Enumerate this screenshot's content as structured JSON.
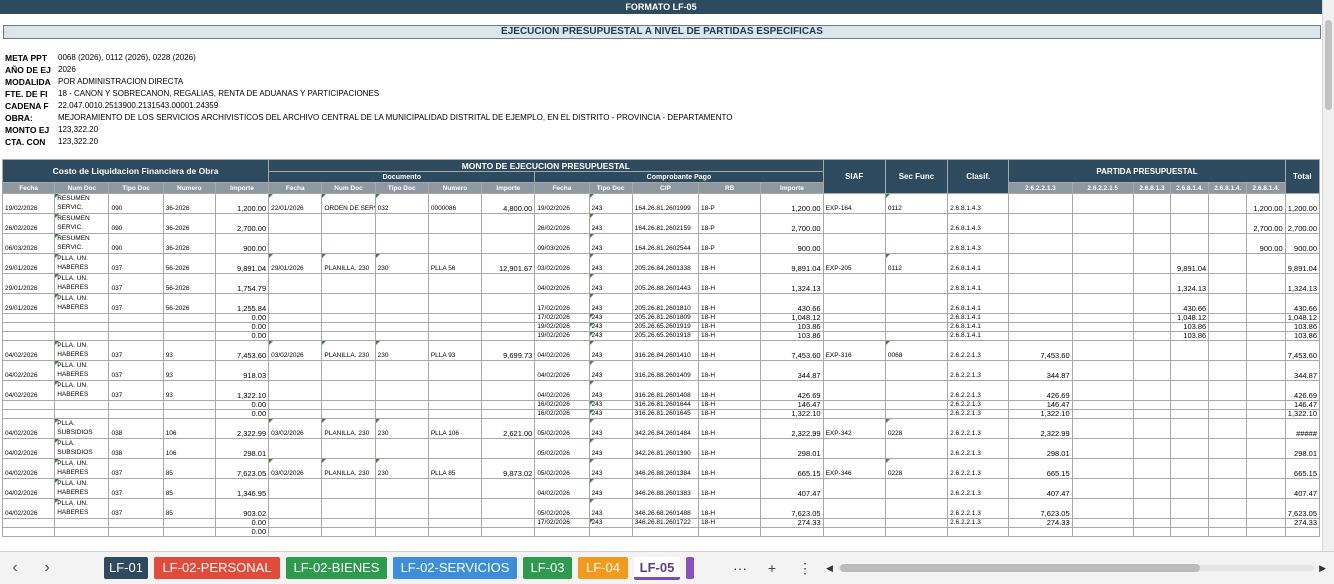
{
  "banner": "FORMATO LF-05",
  "title": "EJECUCION PRESUPUESTAL A NIVEL DE PARTIDAS ESPECIFICAS",
  "info": [
    {
      "label": "META PPT",
      "value": "0068 (2026), 0112 (2026), 0228 (2026)"
    },
    {
      "label": "AÑO DE EJ",
      "value": "2026"
    },
    {
      "label": "MODALIDA",
      "value": "POR ADMINISTRACION DIRECTA"
    },
    {
      "label": "FTE. DE FI",
      "value": "18 - CANON Y SOBRECANON, REGALIAS, RENTA DE ADUANAS Y PARTICIPACIONES"
    },
    {
      "label": "CADENA F",
      "value": "22.047.0010.2513900.2131543.00001.24359"
    },
    {
      "label": "OBRA:",
      "value": "MEJORAMIENTO DE LOS SERVICIOS ARCHIVISTICOS DEL ARCHIVO CENTRAL DE LA MUNICIPALIDAD DISTRITAL DE EJEMPLO, EN EL DISTRITO - PROVINCIA - DEPARTAMENTO"
    },
    {
      "label": "MONTO EJ",
      "value": "123,322.20"
    },
    {
      "label": "CTA. CON",
      "value": "123,322.20"
    }
  ],
  "headers": {
    "costo": "Costo de Liquidacion Financiera de Obra",
    "monto": "MONTO DE EJECUCION PRESUPUESTAL",
    "documento": "Documento",
    "comprobante": "Comprobante Pago",
    "siaf": "SIAF",
    "sec_func": "Sec Func",
    "clasif": "Clasif.",
    "partida": "PARTIDA PRESUPUESTAL",
    "total": "Total",
    "sub": [
      "Fecha",
      "Num Doc",
      "Tipo Doc",
      "Numero",
      "Importe",
      "Fecha",
      "Num Doc",
      "Tipo Doc",
      "Numero",
      "Importe",
      "Fecha",
      "Tipo Doc",
      "C/P",
      "RB",
      "Importe"
    ],
    "partidas": [
      "2.6.2.2.1.3",
      "2.6.2.2.1.5",
      "2.6.8.1.3",
      "2.6.8.1.4.",
      "2.6.8.1.4.",
      "2.6.8.1.4."
    ]
  },
  "rows": [
    {
      "h": 2,
      "c": [
        "19/02/2026",
        "RESUMEN SERVIC.",
        "090",
        "36-2026",
        "1,200.00",
        "22/01/2026",
        "ORDEN DE SERVIC.",
        "032",
        "0000086",
        "4,800.00",
        "19/02/2026",
        "243",
        "164.26.81.2601999",
        "18-P",
        "1,200.00",
        "EXP-164",
        "0112",
        "2.6.8.1.4.3",
        "",
        "",
        "",
        "",
        "",
        "1,200.00",
        "1,200.00"
      ]
    },
    {
      "h": 2,
      "c": [
        "26/02/2026",
        "RESUMEN SERVIC.",
        "090",
        "36-2026",
        "2,700.00",
        "",
        "",
        "",
        "",
        "",
        "26/02/2026",
        "243",
        "164.26.81.2602159",
        "18-P",
        "2,700.00",
        "",
        "",
        "2.6.8.1.4.3",
        "",
        "",
        "",
        "",
        "",
        "2,700.00",
        "2,700.00"
      ]
    },
    {
      "h": 2,
      "c": [
        "06/03/2026",
        "RESUMEN SERVIC.",
        "090",
        "36-2026",
        "900.00",
        "",
        "",
        "",
        "",
        "",
        "09/03/2026",
        "243",
        "164.26.81.2602544",
        "18-P",
        "900.00",
        "",
        "",
        "2.6.8.1.4.3",
        "",
        "",
        "",
        "",
        "",
        "900.00",
        "900.00"
      ]
    },
    {
      "h": 2,
      "c": [
        "29/01/2026",
        "PLLA. UN. HABERES",
        "037",
        "56-2026",
        "9,891.04",
        "29/01/2026",
        "PLANILLA. 230",
        "230",
        "PLLA 56",
        "12,901.67",
        "03/02/2026",
        "243",
        "205.26.84.2601338",
        "18-H",
        "9,891.04",
        "EXP-205",
        "0112",
        "2.6.8.1.4.1",
        "",
        "",
        "",
        "9,891.04",
        "",
        "",
        "9,891.04"
      ]
    },
    {
      "h": 2,
      "c": [
        "29/01/2026",
        "PLLA. UN. HABERES",
        "037",
        "56-2026",
        "1,754.79",
        "",
        "",
        "",
        "",
        "",
        "04/02/2026",
        "243",
        "205.26.88.2601443",
        "18-H",
        "1,324.13",
        "",
        "",
        "2.6.8.1.4.1",
        "",
        "",
        "",
        "1,324.13",
        "",
        "",
        "1,324.13"
      ]
    },
    {
      "h": 2,
      "c": [
        "29/01/2026",
        "PLLA. UN. HABERES",
        "037",
        "56-2026",
        "1,255.84",
        "",
        "",
        "",
        "",
        "",
        "17/02/2026",
        "243",
        "205.26.81.2601810",
        "18-H",
        "430.66",
        "",
        "",
        "2.6.8.1.4.1",
        "",
        "",
        "",
        "430.66",
        "",
        "",
        "430.66"
      ]
    },
    {
      "h": 1,
      "c": [
        "",
        "",
        "",
        "",
        "0.00",
        "",
        "",
        "",
        "",
        "",
        "17/02/2026",
        "243",
        "205.26.81.2601809",
        "18-H",
        "1,048.12",
        "",
        "",
        "2.6.8.1.4.1",
        "",
        "",
        "",
        "1,048.12",
        "",
        "",
        "1,048.12"
      ]
    },
    {
      "h": 1,
      "c": [
        "",
        "",
        "",
        "",
        "0.00",
        "",
        "",
        "",
        "",
        "",
        "19/02/2026",
        "243",
        "205.26.65.2601919",
        "18-H",
        "103.86",
        "",
        "",
        "2.6.8.1.4.1",
        "",
        "",
        "",
        "103.86",
        "",
        "",
        "103.86"
      ]
    },
    {
      "h": 1,
      "c": [
        "",
        "",
        "",
        "",
        "0.00",
        "",
        "",
        "",
        "",
        "",
        "19/02/2026",
        "243",
        "205.26.65.2601918",
        "18-H",
        "103.86",
        "",
        "",
        "2.6.8.1.4.1",
        "",
        "",
        "",
        "103.86",
        "",
        "",
        "103.86"
      ]
    },
    {
      "h": 2,
      "c": [
        "04/02/2026",
        "PLLA. UN. HABERES",
        "037",
        "93",
        "7,453.60",
        "03/02/2026",
        "PLANILLA. 230",
        "230",
        "PLLA 93",
        "9,699.73",
        "04/02/2026",
        "243",
        "316.26.84.2601410",
        "18-H",
        "7,453.60",
        "EXP-316",
        "0068",
        "2.6.2.2.1.3",
        "7,453.60",
        "",
        "",
        "",
        "",
        "",
        "7,453.60"
      ]
    },
    {
      "h": 2,
      "c": [
        "04/02/2026",
        "PLLA. UN. HABERES",
        "037",
        "93",
        "918.03",
        "",
        "",
        "",
        "",
        "",
        "04/02/2026",
        "243",
        "316.26.88.2601409",
        "18-H",
        "344.87",
        "",
        "",
        "2.6.2.2.1.3",
        "344.87",
        "",
        "",
        "",
        "",
        "",
        "344.87"
      ]
    },
    {
      "h": 2,
      "c": [
        "04/02/2026",
        "PLLA. UN. HABERES",
        "037",
        "93",
        "1,322.10",
        "",
        "",
        "",
        "",
        "",
        "04/02/2026",
        "243",
        "316.26.81.2601408",
        "18-H",
        "426.69",
        "",
        "",
        "2.6.2.2.1.3",
        "426.69",
        "",
        "",
        "",
        "",
        "",
        "426.69"
      ]
    },
    {
      "h": 1,
      "c": [
        "",
        "",
        "",
        "",
        "0.00",
        "",
        "",
        "",
        "",
        "",
        "16/02/2026",
        "243",
        "316.26.81.2601644",
        "18-H",
        "146.47",
        "",
        "",
        "2.6.2.2.1.3",
        "146.47",
        "",
        "",
        "",
        "",
        "",
        "146.47"
      ]
    },
    {
      "h": 1,
      "c": [
        "",
        "",
        "",
        "",
        "0.00",
        "",
        "",
        "",
        "",
        "",
        "16/02/2026",
        "243",
        "316.26.81.2601645",
        "18-H",
        "1,322.10",
        "",
        "",
        "2.6.2.2.1.3",
        "1,322.10",
        "",
        "",
        "",
        "",
        "",
        "1,322.10"
      ]
    },
    {
      "h": 2,
      "c": [
        "04/02/2026",
        "PLLA. SUBSIDIOS",
        "038",
        "106",
        "2,322.99",
        "03/02/2026",
        "PLANILLA. 230",
        "230",
        "PLLA 106",
        "2,621.00",
        "05/02/2026",
        "243",
        "342.26.84.2601484",
        "18-H",
        "2,322.99",
        "EXP-342",
        "0228",
        "2.6.2.2.1.3",
        "2,322.99",
        "",
        "",
        "",
        "",
        "",
        "#####"
      ]
    },
    {
      "h": 2,
      "c": [
        "04/02/2026",
        "PLLA. SUBSIDIOS",
        "038",
        "106",
        "298.01",
        "",
        "",
        "",
        "",
        "",
        "05/02/2026",
        "243",
        "342.26.81.2601390",
        "18-H",
        "298.01",
        "",
        "",
        "2.6.2.2.1.3",
        "298.01",
        "",
        "",
        "",
        "",
        "",
        "298.01"
      ]
    },
    {
      "h": 2,
      "c": [
        "04/02/2026",
        "PLLA. UN. HABERES",
        "037",
        "85",
        "7,623.05",
        "03/02/2026",
        "PLANILLA. 230",
        "230",
        "PLLA 85",
        "9,873.02",
        "05/02/2026",
        "243",
        "346.26.88.2601384",
        "18-H",
        "665.15",
        "EXP-346",
        "0228",
        "2.6.2.2.1.3",
        "665.15",
        "",
        "",
        "",
        "",
        "",
        "665.15"
      ]
    },
    {
      "h": 2,
      "c": [
        "04/02/2026",
        "PLLA. UN. HABERES",
        "037",
        "85",
        "1,346.95",
        "",
        "",
        "",
        "",
        "",
        "04/02/2026",
        "243",
        "346.26.88.2601383",
        "18-H",
        "407.47",
        "",
        "",
        "2.6.2.2.1.3",
        "407.47",
        "",
        "",
        "",
        "",
        "",
        "407.47"
      ]
    },
    {
      "h": 2,
      "c": [
        "04/02/2026",
        "PLLA. UN. HABERES",
        "037",
        "85",
        "903.02",
        "",
        "",
        "",
        "",
        "",
        "05/02/2026",
        "243",
        "346.26.68.2601488",
        "18-H",
        "7,623.05",
        "",
        "",
        "2.6.2.2.1.3",
        "7,623.05",
        "",
        "",
        "",
        "",
        "",
        "7,623.05"
      ]
    },
    {
      "h": 1,
      "c": [
        "",
        "",
        "",
        "",
        "0.00",
        "",
        "",
        "",
        "",
        "",
        "17/02/2026",
        "243",
        "346.26.81.2601722",
        "18-H",
        "274.33",
        "",
        "",
        "2.6.2.2.1.3",
        "274.33",
        "",
        "",
        "",
        "",
        "",
        "274.33"
      ]
    },
    {
      "h": 1,
      "c": [
        "",
        "",
        "",
        "",
        "0.00",
        "",
        "",
        "",
        "",
        "",
        "",
        "",
        "",
        "",
        "",
        "",
        "",
        "",
        "",
        "",
        "",
        "",
        "",
        "",
        ""
      ]
    }
  ],
  "tabs": [
    {
      "label": "LF-01",
      "bg": "#2e4a5e",
      "fg": "#ffffff"
    },
    {
      "label": "LF-02-PERSONAL",
      "bg": "#e04b3c",
      "fg": "#ffffff"
    },
    {
      "label": "LF-02-BIENES",
      "bg": "#2e9a4e",
      "fg": "#ffffff"
    },
    {
      "label": "LF-02-SERVICIOS",
      "bg": "#3c8ed8",
      "fg": "#ffffff"
    },
    {
      "label": "LF-03",
      "bg": "#2e9a4e",
      "fg": "#ffffff"
    },
    {
      "label": "LF-04",
      "bg": "#f09a1e",
      "fg": "#ffffff"
    },
    {
      "label": "LF-05",
      "bg": "#ffffff",
      "fg": "#5a3d8a",
      "active": true
    },
    {
      "label": "",
      "bg": "#8a4fc2",
      "fg": "#ffffff"
    }
  ],
  "tab_controls": {
    "more": "···",
    "add": "+",
    "menu": "⋮",
    "prev": "‹",
    "next": "›"
  }
}
